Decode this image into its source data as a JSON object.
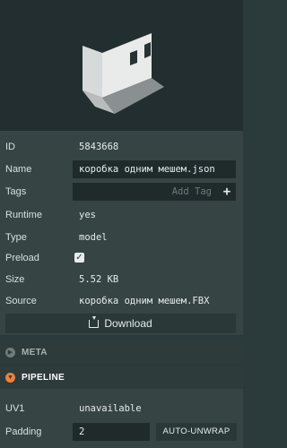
{
  "asset": {
    "id_label": "ID",
    "id": "5843668",
    "name_label": "Name",
    "name": "коробка одним мешем.json",
    "tags_label": "Tags",
    "tags_placeholder": "Add Tag",
    "runtime_label": "Runtime",
    "runtime": "yes",
    "type_label": "Type",
    "type": "model",
    "preload_label": "Preload",
    "preload_checked": true,
    "size_label": "Size",
    "size": "5.52 KB",
    "source_label": "Source",
    "source": "коробка одним мешем.FBX",
    "download_label": "Download"
  },
  "sections": {
    "meta": {
      "title": "META",
      "expanded": false
    },
    "pipeline": {
      "title": "PIPELINE",
      "expanded": true
    }
  },
  "pipeline": {
    "uv1_label": "UV1",
    "uv1": "unavailable",
    "padding_label": "Padding",
    "padding": "2",
    "auto_unwrap_label": "AUTO-UNWRAP"
  },
  "colors": {
    "accent": "#f0813a",
    "panel": "#364444",
    "field": "#1f2a2b"
  }
}
